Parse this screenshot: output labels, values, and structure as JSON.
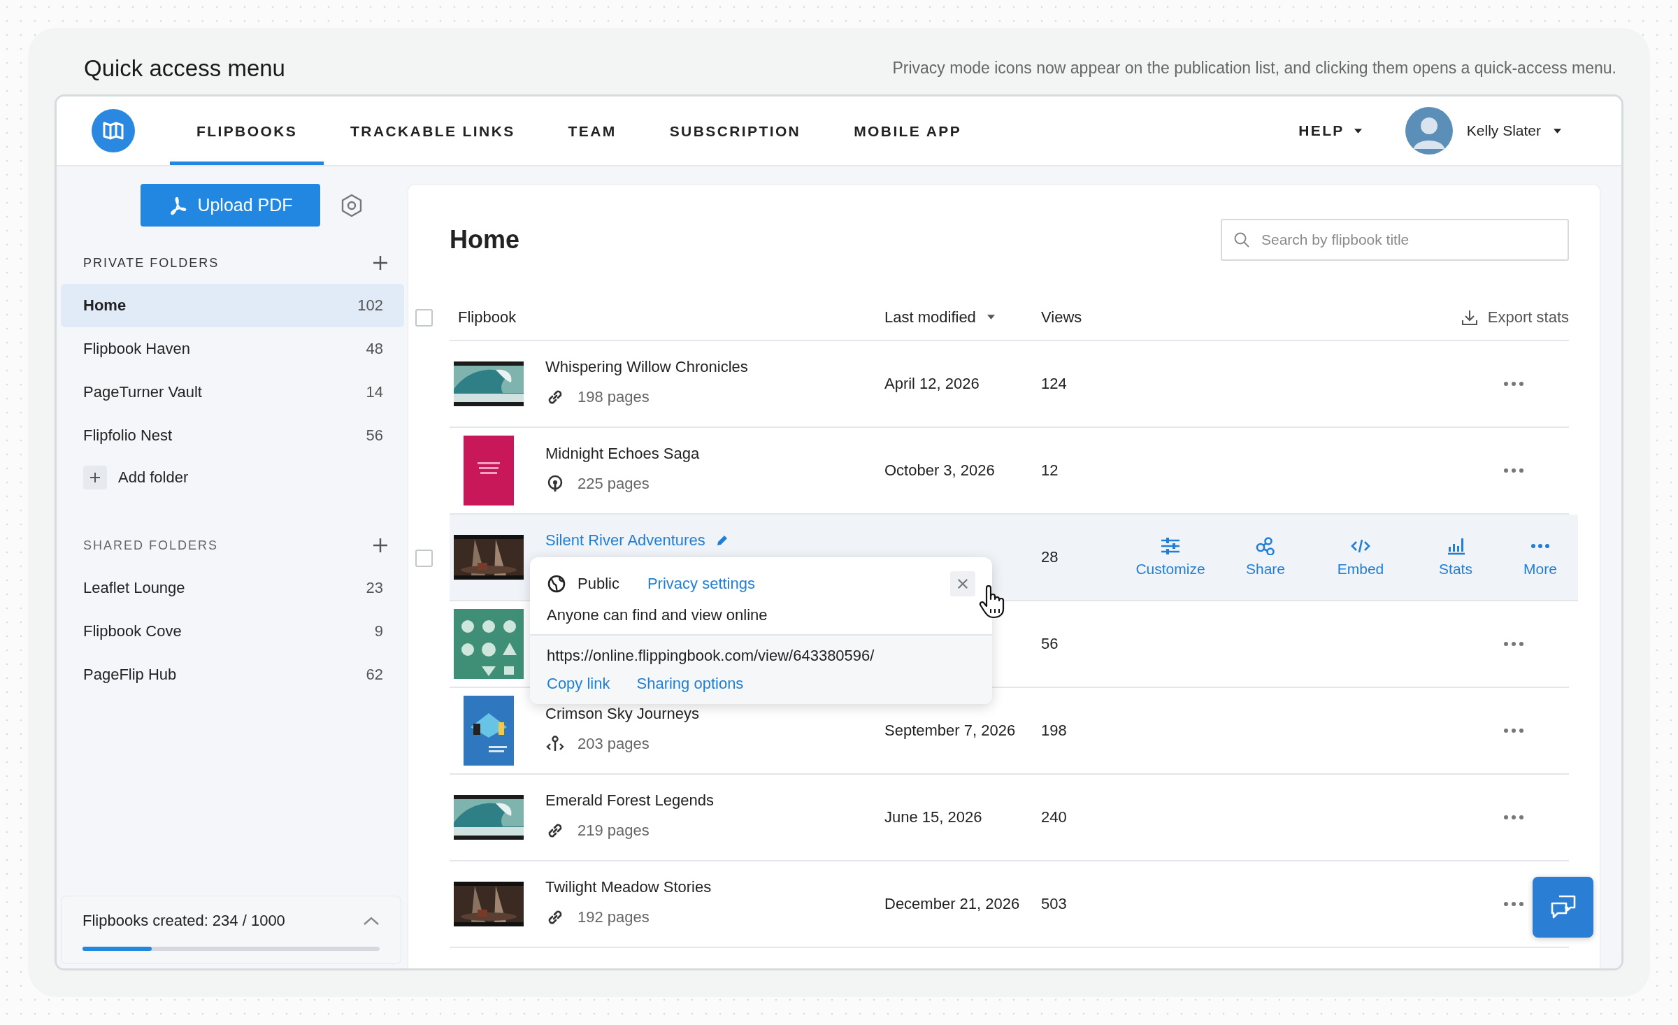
{
  "page": {
    "title": "Quick access menu",
    "description": "Privacy mode icons now appear on the publication list, and clicking them opens a quick-access menu."
  },
  "nav": {
    "tabs": [
      {
        "label": "FLIPBOOKS",
        "selected": true
      },
      {
        "label": "TRACKABLE LINKS",
        "selected": false
      },
      {
        "label": "TEAM",
        "selected": false
      },
      {
        "label": "SUBSCRIPTION",
        "selected": false
      },
      {
        "label": "MOBILE APP",
        "selected": false
      }
    ],
    "help": "HELP",
    "user": "Kelly Slater"
  },
  "sidebar": {
    "upload_button": "Upload PDF",
    "sections": [
      {
        "heading": "PRIVATE FOLDERS",
        "add_label": "Add folder",
        "items": [
          {
            "name": "Home",
            "count": "102",
            "selected": true
          },
          {
            "name": "Flipbook Haven",
            "count": "48",
            "selected": false
          },
          {
            "name": "PageTurner Vault",
            "count": "14",
            "selected": false
          },
          {
            "name": "Flipfolio Nest",
            "count": "56",
            "selected": false
          }
        ]
      },
      {
        "heading": "SHARED FOLDERS",
        "items": [
          {
            "name": "Leaflet Lounge",
            "count": "23",
            "selected": false
          },
          {
            "name": "Flipbook Cove",
            "count": "9",
            "selected": false
          },
          {
            "name": "PageFlip Hub",
            "count": "62",
            "selected": false
          }
        ]
      }
    ],
    "usage": {
      "label": "Flipbooks created: 234 / 1000",
      "level": 0.234
    }
  },
  "main": {
    "title": "Home",
    "search": {
      "placeholder": "Search by flipbook title"
    },
    "select_all": {
      "checked": false
    },
    "columns": [
      "Flipbook",
      "Last modified",
      "Views"
    ],
    "export": "Export stats",
    "rows": [
      {
        "title": "Whispering Willow Chronicles",
        "privacy": {
          "kind": "link"
        },
        "pages": "198 pages",
        "last_modified": "April 12, 2026",
        "views": "124",
        "hovered": false
      },
      {
        "title": "Midnight Echoes Saga",
        "privacy": {
          "kind": "pin"
        },
        "pages": "225 pages",
        "last_modified": "October 3, 2026",
        "views": "12",
        "hovered": false
      },
      {
        "title": "Silent River Adventures",
        "views": "28",
        "hovered": true,
        "checked": false,
        "actions": [
          {
            "label": "Customize",
            "kind": "customize"
          },
          {
            "label": "Share",
            "kind": "share"
          },
          {
            "label": "Embed",
            "kind": "embed"
          },
          {
            "label": "Stats",
            "kind": "stats"
          },
          {
            "label": "More",
            "kind": "more"
          }
        ]
      },
      {
        "views": "56",
        "hovered": false
      },
      {
        "title": "Crimson Sky Journeys",
        "privacy": {
          "kind": "branch"
        },
        "pages": "203 pages",
        "last_modified": "September 7, 2026",
        "views": "198",
        "hovered": false
      },
      {
        "title": "Emerald Forest Legends",
        "privacy": {
          "kind": "link"
        },
        "pages": "219 pages",
        "last_modified": "June 15, 2026",
        "views": "240",
        "hovered": false
      },
      {
        "title": "Twilight Meadow Stories",
        "privacy": {
          "kind": "link"
        },
        "pages": "192 pages",
        "last_modified": "December 21, 2026",
        "views": "503",
        "hovered": false
      }
    ]
  },
  "popup": {
    "privacy": "Public",
    "settings_link": "Privacy settings",
    "description": "Anyone can find and view online",
    "url": "https://online.flippingbook.com/view/643380596/",
    "links": [
      "Copy link",
      "Sharing options"
    ]
  }
}
